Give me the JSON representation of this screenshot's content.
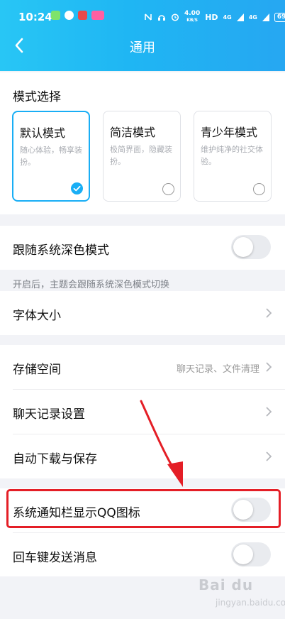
{
  "status_bar": {
    "time": "10:24",
    "net_speed_value": "4.00",
    "net_speed_unit": "KB/S",
    "network_label": "HD",
    "signal_1": "4G",
    "signal_2": "4G",
    "battery": "69"
  },
  "nav": {
    "title": "通用"
  },
  "mode_section": {
    "title": "模式选择",
    "modes": [
      {
        "name": "默认模式",
        "desc": "随心体验，畅享装扮。",
        "selected": true
      },
      {
        "name": "简洁模式",
        "desc": "极简界面，隐藏装扮。",
        "selected": false
      },
      {
        "name": "青少年模式",
        "desc": "维护纯净的社交体验。",
        "selected": false
      }
    ]
  },
  "dark_mode": {
    "label": "跟随系统深色模式",
    "enabled": false,
    "note": "开启后，主题会跟随系统深色模式切换"
  },
  "font_size": {
    "label": "字体大小"
  },
  "storage": {
    "label": "存储空间",
    "hint": "聊天记录、文件清理"
  },
  "chat_history": {
    "label": "聊天记录设置"
  },
  "auto_download": {
    "label": "自动下载与保存"
  },
  "notification_icon": {
    "label": "系统通知栏显示QQ图标",
    "enabled": false
  },
  "enter_send": {
    "label": "回车键发送消息",
    "enabled": false
  },
  "watermark": {
    "brand": "Bai du",
    "sub": "jingyan.baidu.com"
  },
  "colors": {
    "accent": "#19aef5",
    "header_start": "#28c6f5",
    "header_end": "#26a7f2",
    "annotation_red": "#e41e26",
    "background": "#f2f3f7"
  }
}
